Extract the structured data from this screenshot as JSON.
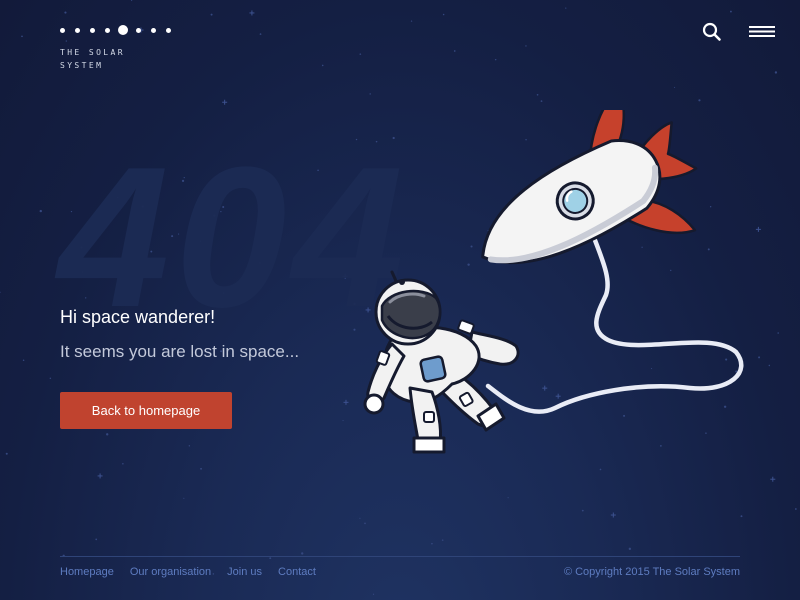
{
  "logo": {
    "line1": "THE SOLAR",
    "line2": "SYSTEM"
  },
  "header": {
    "search_icon": "search-icon",
    "menu_icon": "hamburger-menu-icon"
  },
  "hero": {
    "code": "404",
    "headline": "Hi space wanderer!",
    "subline": "It seems you are lost in space...",
    "button_label": "Back to homepage"
  },
  "footer": {
    "links": [
      "Homepage",
      "Our organisation",
      "Join us",
      "Contact"
    ],
    "copyright": "© Copyright 2015 The Solar System"
  },
  "colors": {
    "background": "#151f45",
    "accent": "#c0432f",
    "link": "#5e7cc0",
    "watermark": "#1c2b54"
  }
}
